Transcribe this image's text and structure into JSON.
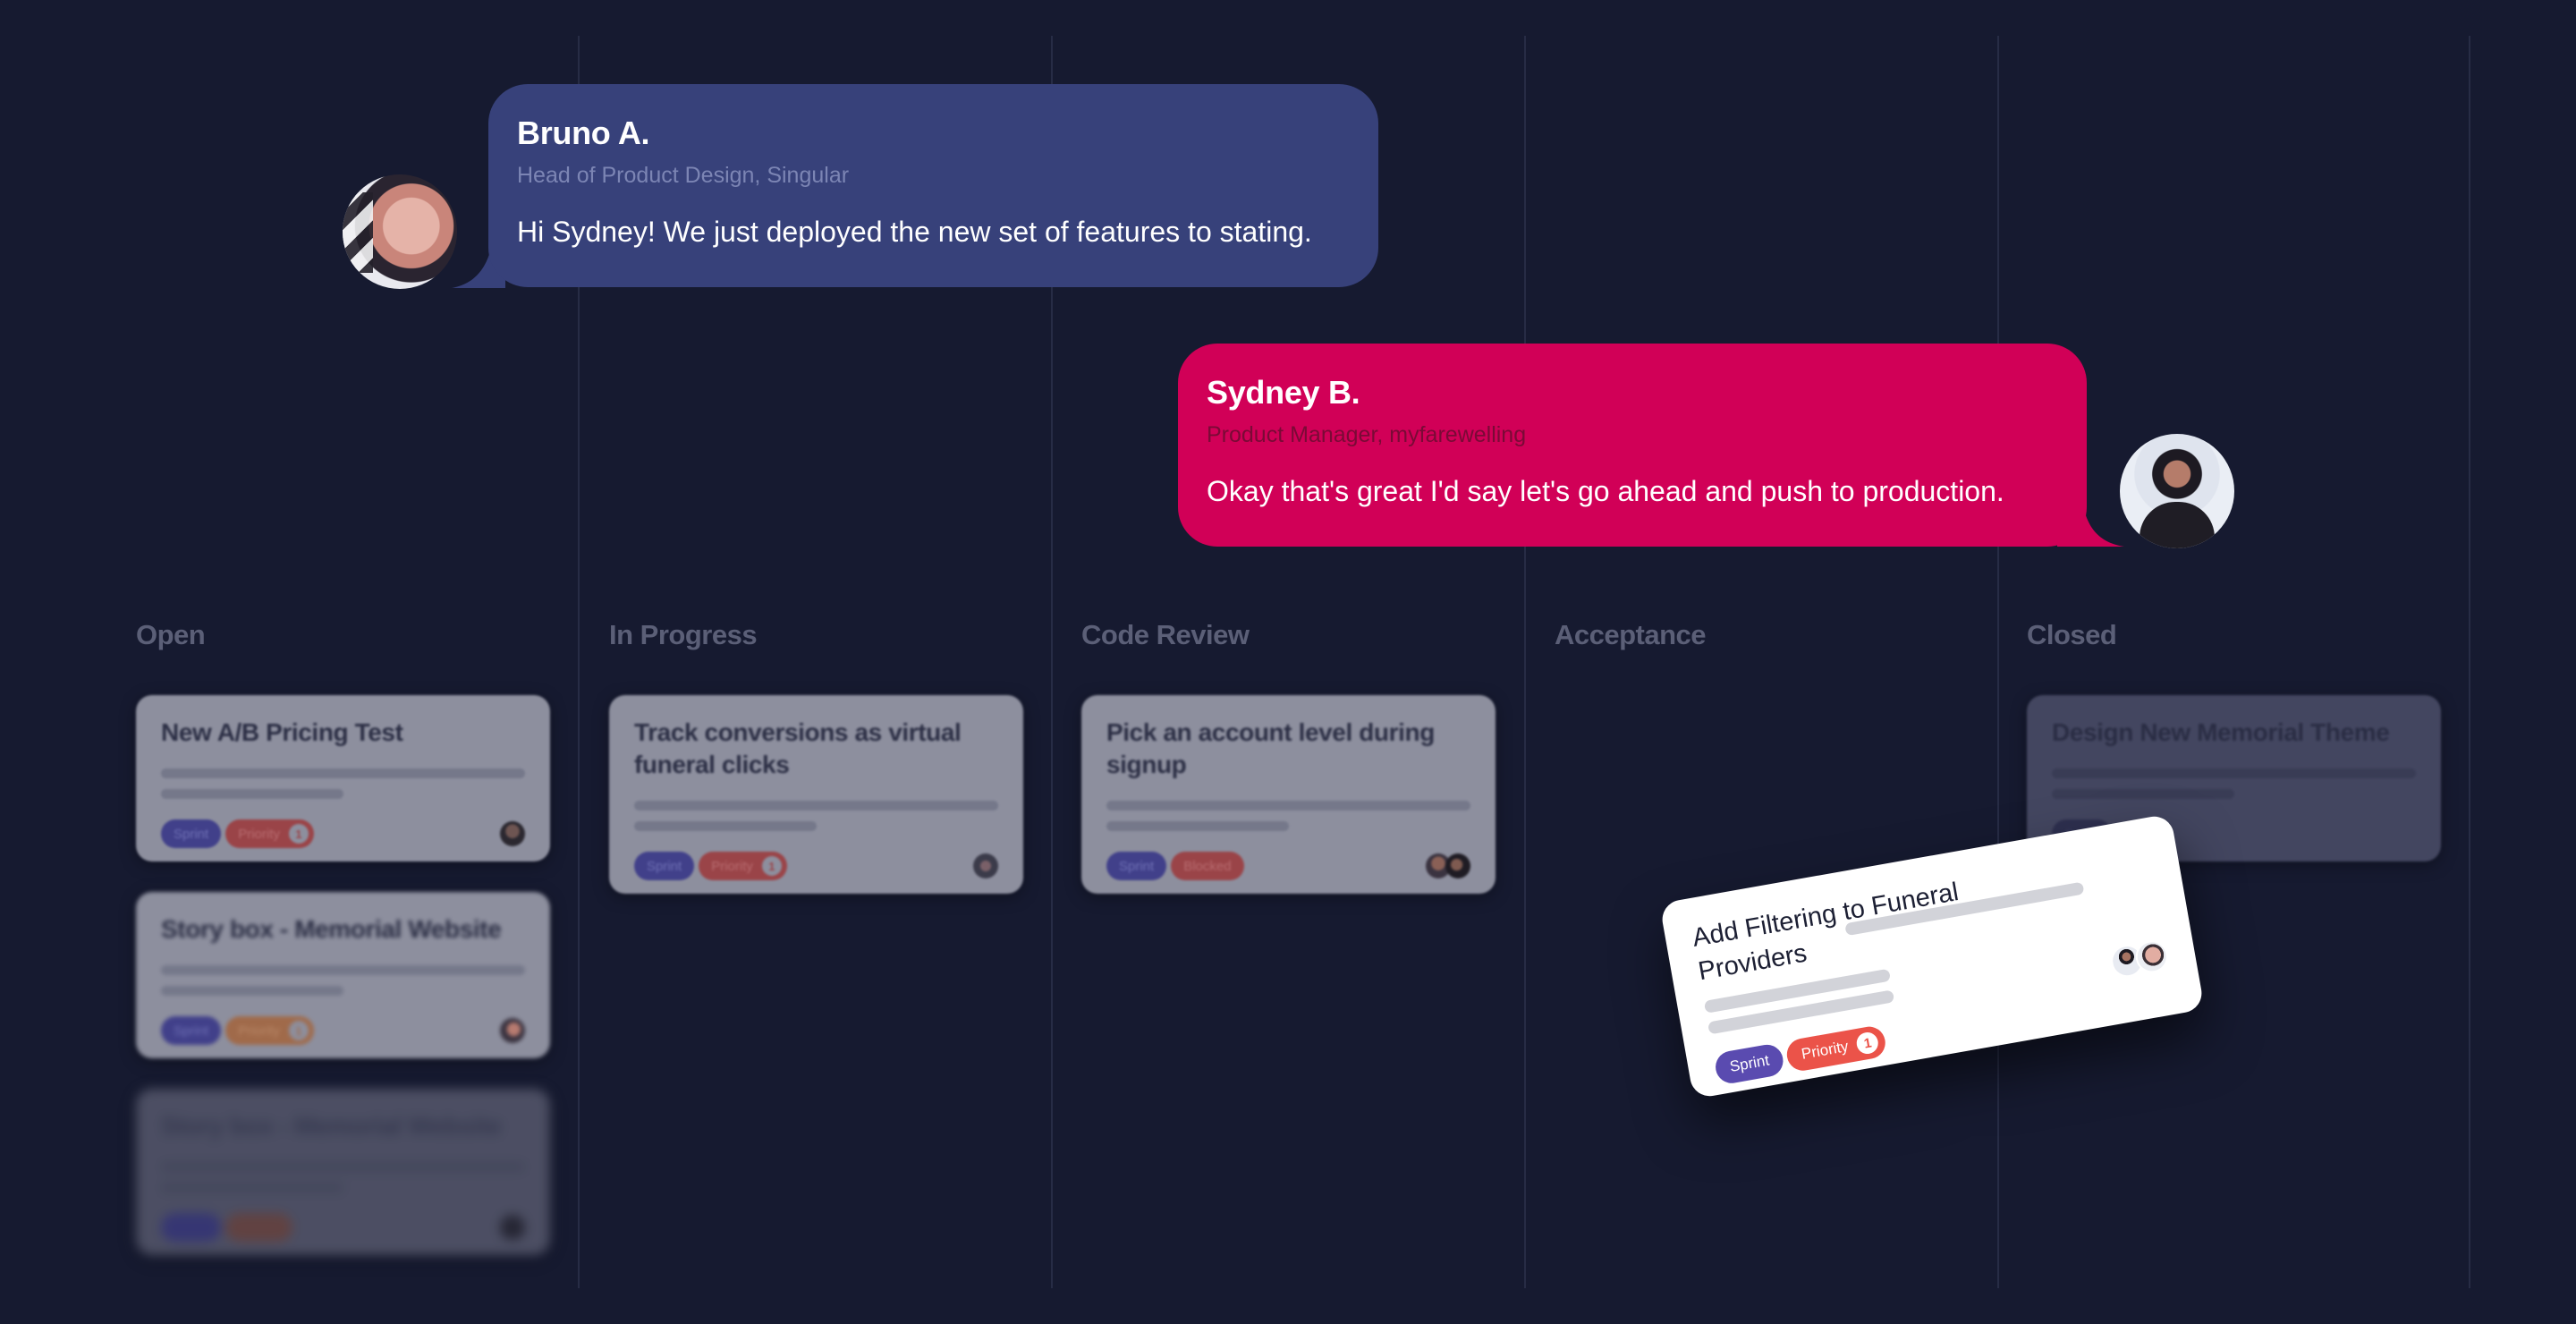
{
  "chat": {
    "messages": [
      {
        "sender": "Bruno A.",
        "role": "Head of Product Design, Singular",
        "text": "Hi Sydney! We just deployed the new set of features to stating.",
        "bubble_color": "#37417a",
        "side": "left"
      },
      {
        "sender": "Sydney B.",
        "role": "Product Manager, myfarewelling",
        "text": "Okay that's great I'd say let's go ahead and push to production.",
        "bubble_color": "#d10057",
        "side": "right"
      }
    ]
  },
  "board": {
    "columns": [
      {
        "title": "Open",
        "cards": [
          {
            "title": "New A/B Pricing Test",
            "tags": [
              {
                "label": "Sprint"
              },
              {
                "label": "Priority",
                "count": "1"
              }
            ]
          },
          {
            "title": "Story box - Memorial Website",
            "tags": [
              {
                "label": "Sprint"
              },
              {
                "label": "Priority",
                "count": "1"
              }
            ]
          },
          {
            "title": "Story box - Memorial Website",
            "tags": [
              {
                "label": "Sprint"
              },
              {
                "label": "Priority"
              }
            ]
          }
        ]
      },
      {
        "title": "In Progress",
        "cards": [
          {
            "title": "Track conversions as virtual funeral clicks",
            "tags": [
              {
                "label": "Sprint"
              },
              {
                "label": "Priority",
                "count": "1"
              }
            ]
          }
        ]
      },
      {
        "title": "Code Review",
        "cards": [
          {
            "title": "Pick an account level during signup",
            "tags": [
              {
                "label": "Sprint"
              },
              {
                "label": "Blocked"
              }
            ]
          }
        ]
      },
      {
        "title": "Acceptance",
        "cards": []
      },
      {
        "title": "Closed",
        "cards": [
          {
            "title": "Design New Memorial Theme",
            "tags": [
              {
                "label": "Sprint"
              }
            ]
          }
        ]
      }
    ],
    "dragged_card": {
      "title": "Add Filtering to Funeral Providers",
      "tags": [
        {
          "label": "Sprint"
        },
        {
          "label": "Priority",
          "count": "1"
        }
      ]
    }
  },
  "colors": {
    "background": "#161a30",
    "sprint": "#5a4bb0",
    "priority": "#eb5349",
    "blocked": "#eb5349"
  }
}
